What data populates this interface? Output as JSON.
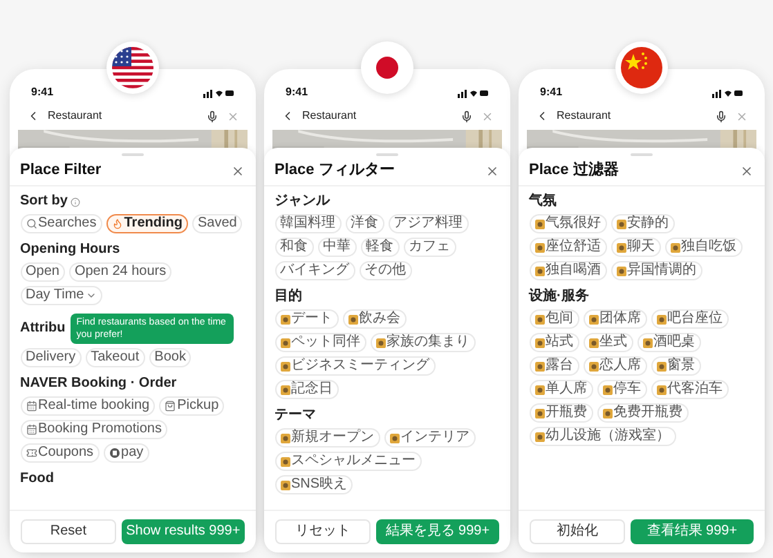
{
  "phones": [
    {
      "time": "9:41",
      "search": "Restaurant",
      "title": "Place Filter",
      "sections": [
        {
          "heading": "Sort by",
          "info": true,
          "chips": [
            {
              "label": "Searches",
              "kind": "search",
              "selected": false
            },
            {
              "label": "Trending",
              "kind": "flame",
              "selected": true
            },
            {
              "label": "Saved",
              "kind": "plain",
              "selected": false
            }
          ]
        },
        {
          "heading": "Opening Hours",
          "chips": [
            {
              "label": "Open",
              "kind": "plain",
              "selected": false
            },
            {
              "label": "Open 24 hours",
              "kind": "plain",
              "selected": false
            },
            {
              "label": "Day Time",
              "kind": "dropdown",
              "selected": false
            }
          ]
        },
        {
          "heading": "Attribu",
          "tooltip": "Find restaurants based on the time you prefer!",
          "chips": [
            {
              "label": "Delivery",
              "kind": "plain",
              "selected": false
            },
            {
              "label": "Takeout",
              "kind": "plain",
              "selected": false
            },
            {
              "label": "Book",
              "kind": "plain",
              "selected": false
            }
          ]
        },
        {
          "heading": "NAVER Booking · Order",
          "chips": [
            {
              "label": "Real-time booking",
              "kind": "calendar",
              "selected": false
            },
            {
              "label": "Pickup",
              "kind": "bag",
              "selected": false
            },
            {
              "label": "Booking Promotions",
              "kind": "calendar",
              "selected": false
            },
            {
              "label": "Coupons",
              "kind": "ticket",
              "selected": false
            },
            {
              "label": "pay",
              "kind": "pay",
              "selected": false
            }
          ]
        },
        {
          "heading": "Food"
        }
      ],
      "reset": "Reset",
      "submit": "Show results 999+"
    },
    {
      "time": "9:41",
      "search": "Restaurant",
      "title": "Place フィルター",
      "sections": [
        {
          "heading": "ジャンル",
          "chips": [
            {
              "label": "韓国料理",
              "kind": "plain",
              "selected": false
            },
            {
              "label": "洋食",
              "kind": "plain",
              "selected": false
            },
            {
              "label": "アジア料理",
              "kind": "plain",
              "selected": false
            },
            {
              "label": "和食",
              "kind": "plain",
              "selected": false
            },
            {
              "label": "中華",
              "kind": "plain",
              "selected": false
            },
            {
              "label": "軽食",
              "kind": "plain",
              "selected": false
            },
            {
              "label": "カフェ",
              "kind": "plain",
              "selected": false
            },
            {
              "label": "バイキング",
              "kind": "plain",
              "selected": false
            },
            {
              "label": "その他",
              "kind": "plain",
              "selected": false
            }
          ]
        },
        {
          "heading": "目的",
          "chips": [
            {
              "label": "デート",
              "kind": "emoji",
              "selected": false
            },
            {
              "label": "飲み会",
              "kind": "emoji",
              "selected": false
            },
            {
              "label": "ペット同伴",
              "kind": "emoji",
              "selected": false
            },
            {
              "label": "家族の集まり",
              "kind": "emoji",
              "selected": false
            },
            {
              "label": "ビジネスミーティング",
              "kind": "emoji",
              "selected": false
            },
            {
              "label": "記念日",
              "kind": "emoji",
              "selected": false
            }
          ]
        },
        {
          "heading": "テーマ",
          "chips": [
            {
              "label": "新規オープン",
              "kind": "emoji",
              "selected": false
            },
            {
              "label": "インテリア",
              "kind": "emoji",
              "selected": false
            },
            {
              "label": "スペシャルメニュー",
              "kind": "emoji",
              "selected": false
            },
            {
              "label": "SNS映え",
              "kind": "emoji",
              "selected": false
            }
          ]
        }
      ],
      "reset": "リセット",
      "submit": "結果を見る 999+"
    },
    {
      "time": "9:41",
      "search": "Restaurant",
      "title": "Place 过滤器",
      "sections": [
        {
          "heading": "气氛",
          "chips": [
            {
              "label": "气氛很好",
              "kind": "emoji",
              "selected": false
            },
            {
              "label": "安静的",
              "kind": "emoji",
              "selected": false
            },
            {
              "label": "座位舒适",
              "kind": "emoji",
              "selected": false
            },
            {
              "label": "聊天",
              "kind": "emoji",
              "selected": false
            },
            {
              "label": "独自吃饭",
              "kind": "emoji",
              "selected": false
            },
            {
              "label": "独自喝酒",
              "kind": "emoji",
              "selected": false
            },
            {
              "label": "异国情调的",
              "kind": "emoji",
              "selected": false
            }
          ]
        },
        {
          "heading": "设施·服务",
          "chips": [
            {
              "label": "包间",
              "kind": "emoji",
              "selected": false
            },
            {
              "label": "团体席",
              "kind": "emoji",
              "selected": false
            },
            {
              "label": "吧台座位",
              "kind": "emoji",
              "selected": false
            },
            {
              "label": "站式",
              "kind": "emoji",
              "selected": false
            },
            {
              "label": "坐式",
              "kind": "emoji",
              "selected": false
            },
            {
              "label": "酒吧桌",
              "kind": "emoji",
              "selected": false
            },
            {
              "label": "露台",
              "kind": "emoji",
              "selected": false
            },
            {
              "label": "恋人席",
              "kind": "emoji",
              "selected": false
            },
            {
              "label": "窗景",
              "kind": "emoji",
              "selected": false
            },
            {
              "label": "单人席",
              "kind": "emoji",
              "selected": false
            },
            {
              "label": "停车",
              "kind": "emoji",
              "selected": false
            },
            {
              "label": "代客泊车",
              "kind": "emoji",
              "selected": false
            },
            {
              "label": "开瓶费",
              "kind": "emoji",
              "selected": false
            },
            {
              "label": "免费开瓶费",
              "kind": "emoji",
              "selected": false
            },
            {
              "label": "幼儿设施（游戏室）",
              "kind": "emoji",
              "selected": false
            }
          ]
        }
      ],
      "reset": "初始化",
      "submit": "查看结果 999+"
    }
  ]
}
